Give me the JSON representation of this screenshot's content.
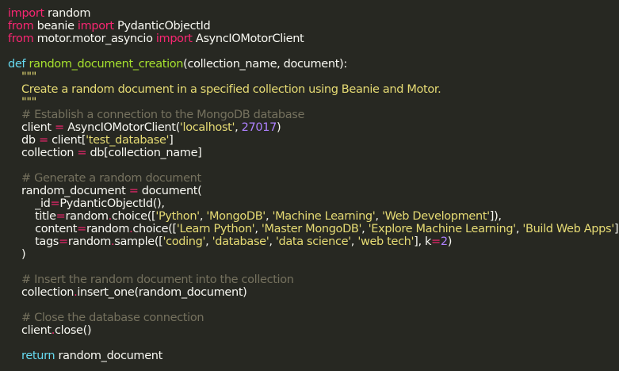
{
  "editor": {
    "theme_colors": {
      "background": "#272822",
      "keyword": "#f92672",
      "def_keyword": "#66d9ef",
      "function_name": "#a6e22e",
      "string": "#e6db74",
      "comment": "#75715e",
      "number": "#ae81ff",
      "plain": "#f8f8f2"
    },
    "lines": [
      [
        [
          "kw",
          "import"
        ],
        [
          "plain",
          " random"
        ]
      ],
      [
        [
          "kw",
          "from"
        ],
        [
          "plain",
          " beanie "
        ],
        [
          "kw",
          "import"
        ],
        [
          "plain",
          " PydanticObjectId"
        ]
      ],
      [
        [
          "kw",
          "from"
        ],
        [
          "plain",
          " motor.motor_asyncio "
        ],
        [
          "kw",
          "import"
        ],
        [
          "plain",
          " AsyncIOMotorClient"
        ]
      ],
      [],
      [
        [
          "def",
          "def"
        ],
        [
          "plain",
          " "
        ],
        [
          "fn",
          "random_document_creation"
        ],
        [
          "plain",
          "(collection_name, document):"
        ]
      ],
      [
        [
          "str",
          "    \"\"\""
        ]
      ],
      [
        [
          "str",
          "    Create a random document in a specified collection using Beanie and Motor."
        ]
      ],
      [
        [
          "str",
          "    \"\"\""
        ]
      ],
      [
        [
          "cmt",
          "    # Establish a connection to the MongoDB database"
        ]
      ],
      [
        [
          "plain",
          "    client "
        ],
        [
          "op",
          "="
        ],
        [
          "plain",
          " AsyncIOMotorClient("
        ],
        [
          "str",
          "'localhost'"
        ],
        [
          "plain",
          ", "
        ],
        [
          "num",
          "27017"
        ],
        [
          "plain",
          ")"
        ]
      ],
      [
        [
          "plain",
          "    db "
        ],
        [
          "op",
          "="
        ],
        [
          "plain",
          " client["
        ],
        [
          "str",
          "'test_database'"
        ],
        [
          "plain",
          "]"
        ]
      ],
      [
        [
          "plain",
          "    collection "
        ],
        [
          "op",
          "="
        ],
        [
          "plain",
          " db[collection_name]"
        ]
      ],
      [],
      [
        [
          "cmt",
          "    # Generate a random document"
        ]
      ],
      [
        [
          "plain",
          "    random_document "
        ],
        [
          "op",
          "="
        ],
        [
          "plain",
          " document("
        ]
      ],
      [
        [
          "plain",
          "        _id"
        ],
        [
          "op",
          "="
        ],
        [
          "plain",
          "PydanticObjectId(),"
        ]
      ],
      [
        [
          "plain",
          "        title"
        ],
        [
          "op",
          "="
        ],
        [
          "plain",
          "random"
        ],
        [
          "op",
          "."
        ],
        [
          "plain",
          "choice(["
        ],
        [
          "str",
          "'Python'"
        ],
        [
          "plain",
          ", "
        ],
        [
          "str",
          "'MongoDB'"
        ],
        [
          "plain",
          ", "
        ],
        [
          "str",
          "'Machine Learning'"
        ],
        [
          "plain",
          ", "
        ],
        [
          "str",
          "'Web Development'"
        ],
        [
          "plain",
          "]),"
        ]
      ],
      [
        [
          "plain",
          "        content"
        ],
        [
          "op",
          "="
        ],
        [
          "plain",
          "random"
        ],
        [
          "op",
          "."
        ],
        [
          "plain",
          "choice(["
        ],
        [
          "str",
          "'Learn Python'"
        ],
        [
          "plain",
          ", "
        ],
        [
          "str",
          "'Master MongoDB'"
        ],
        [
          "plain",
          ", "
        ],
        [
          "str",
          "'Explore Machine Learning'"
        ],
        [
          "plain",
          ", "
        ],
        [
          "str",
          "'Build Web Apps'"
        ],
        [
          "plain",
          "]),"
        ]
      ],
      [
        [
          "plain",
          "        tags"
        ],
        [
          "op",
          "="
        ],
        [
          "plain",
          "random"
        ],
        [
          "op",
          "."
        ],
        [
          "plain",
          "sample(["
        ],
        [
          "str",
          "'coding'"
        ],
        [
          "plain",
          ", "
        ],
        [
          "str",
          "'database'"
        ],
        [
          "plain",
          ", "
        ],
        [
          "str",
          "'data science'"
        ],
        [
          "plain",
          ", "
        ],
        [
          "str",
          "'web tech'"
        ],
        [
          "plain",
          "], k"
        ],
        [
          "op",
          "="
        ],
        [
          "num",
          "2"
        ],
        [
          "plain",
          ")"
        ]
      ],
      [
        [
          "plain",
          "    )"
        ]
      ],
      [],
      [
        [
          "cmt",
          "    # Insert the random document into the collection"
        ]
      ],
      [
        [
          "plain",
          "    collection"
        ],
        [
          "op",
          "."
        ],
        [
          "plain",
          "insert_one(random_document)"
        ]
      ],
      [],
      [
        [
          "cmt",
          "    # Close the database connection"
        ]
      ],
      [
        [
          "plain",
          "    client"
        ],
        [
          "op",
          "."
        ],
        [
          "plain",
          "close()"
        ]
      ],
      [],
      [
        [
          "def",
          "    return"
        ],
        [
          "plain",
          " random_document"
        ]
      ]
    ]
  }
}
